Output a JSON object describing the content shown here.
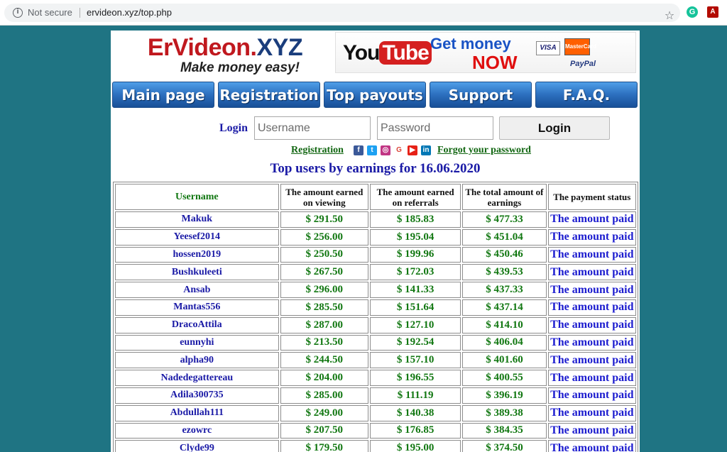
{
  "browser": {
    "security_label": "Not secure",
    "url": "ervideon.xyz/top.php",
    "info_icon": "info-icon",
    "star_icon": "star-icon"
  },
  "logo": {
    "title_main": "ErVideon.",
    "title_ext": "XYZ",
    "tagline": "Make money easy!"
  },
  "banner": {
    "you": "You",
    "tube": "Tube",
    "get_money": "Get money",
    "now": "NOW",
    "visa": "VISA",
    "mastercard": "MasterCard",
    "paypal": "PayPal"
  },
  "nav": [
    {
      "label": "Main page"
    },
    {
      "label": "Registration"
    },
    {
      "label": "Top payouts"
    },
    {
      "label": "Support"
    },
    {
      "label": "F.A.Q."
    }
  ],
  "login": {
    "label": "Login",
    "username_placeholder": "Username",
    "password_placeholder": "Password",
    "button": "Login"
  },
  "links": {
    "registration": "Registration",
    "forgot": "Forgot your password"
  },
  "social_icons": [
    "facebook-icon",
    "twitter-icon",
    "instagram-icon",
    "google-icon",
    "youtube-icon",
    "linkedin-icon"
  ],
  "top_title": "Top users by earnings for 16.06.2020",
  "table": {
    "headers": {
      "username": "Username",
      "viewing": "The amount earned on viewing",
      "referrals": "The amount earned on referrals",
      "total": "The total amount of earnings",
      "status": "The payment status"
    },
    "rows": [
      {
        "user": "Makuk",
        "viewing": "$ 291.50",
        "referrals": "$ 185.83",
        "total": "$ 477.33",
        "status": "The amount paid"
      },
      {
        "user": "Yeesef2014",
        "viewing": "$ 256.00",
        "referrals": "$ 195.04",
        "total": "$ 451.04",
        "status": "The amount paid"
      },
      {
        "user": "hossen2019",
        "viewing": "$ 250.50",
        "referrals": "$ 199.96",
        "total": "$ 450.46",
        "status": "The amount paid"
      },
      {
        "user": "Bushkuleeti",
        "viewing": "$ 267.50",
        "referrals": "$ 172.03",
        "total": "$ 439.53",
        "status": "The amount paid"
      },
      {
        "user": "Ansab",
        "viewing": "$ 296.00",
        "referrals": "$ 141.33",
        "total": "$ 437.33",
        "status": "The amount paid"
      },
      {
        "user": "Mantas556",
        "viewing": "$ 285.50",
        "referrals": "$ 151.64",
        "total": "$ 437.14",
        "status": "The amount paid"
      },
      {
        "user": "DracoAttila",
        "viewing": "$ 287.00",
        "referrals": "$ 127.10",
        "total": "$ 414.10",
        "status": "The amount paid"
      },
      {
        "user": "eunnyhi",
        "viewing": "$ 213.50",
        "referrals": "$ 192.54",
        "total": "$ 406.04",
        "status": "The amount paid"
      },
      {
        "user": "alpha90",
        "viewing": "$ 244.50",
        "referrals": "$ 157.10",
        "total": "$ 401.60",
        "status": "The amount paid"
      },
      {
        "user": "Nadedegattereau",
        "viewing": "$ 204.00",
        "referrals": "$ 196.55",
        "total": "$ 400.55",
        "status": "The amount paid"
      },
      {
        "user": "Adila300735",
        "viewing": "$ 285.00",
        "referrals": "$ 111.19",
        "total": "$ 396.19",
        "status": "The amount paid"
      },
      {
        "user": "Abdullah111",
        "viewing": "$ 249.00",
        "referrals": "$ 140.38",
        "total": "$ 389.38",
        "status": "The amount paid"
      },
      {
        "user": "ezowrc",
        "viewing": "$ 207.50",
        "referrals": "$ 176.85",
        "total": "$ 384.35",
        "status": "The amount paid"
      },
      {
        "user": "Clyde99",
        "viewing": "$ 179.50",
        "referrals": "$ 195.00",
        "total": "$ 374.50",
        "status": "The amount paid"
      }
    ]
  }
}
